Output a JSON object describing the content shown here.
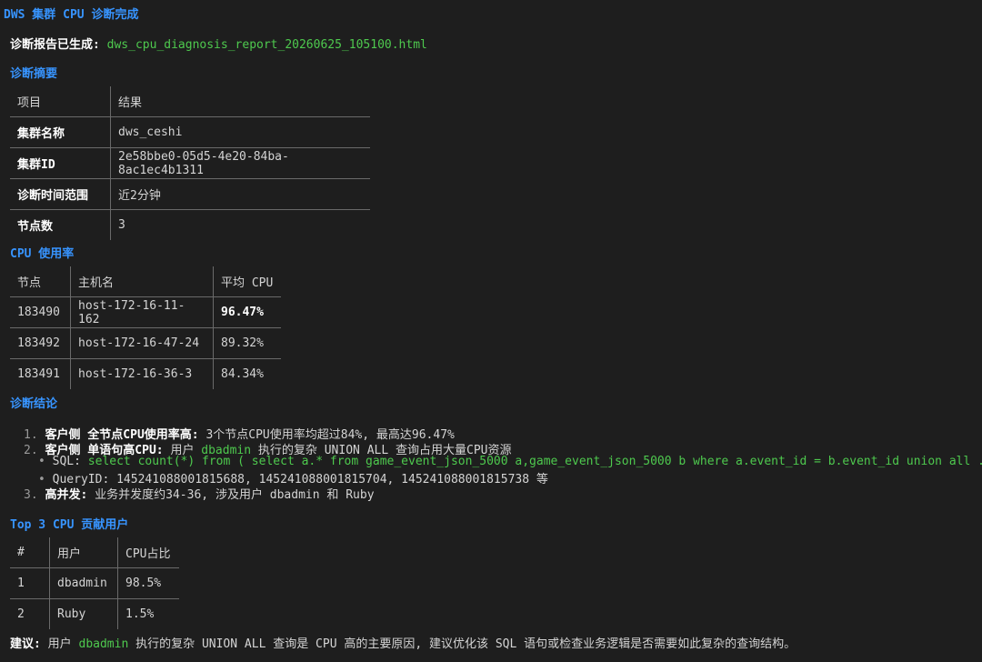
{
  "header": {
    "title": "DWS 集群 CPU 诊断完成"
  },
  "report": {
    "label": "诊断报告已生成:",
    "filename": "dws_cpu_diagnosis_report_20260625_105100.html"
  },
  "summary": {
    "heading": "诊断摘要",
    "columns": [
      "项目",
      "结果"
    ],
    "rows": [
      [
        "集群名称",
        "dws_ceshi"
      ],
      [
        "集群ID",
        "2e58bbe0-05d5-4e20-84ba-8ac1ec4b1311"
      ],
      [
        "诊断时间范围",
        "近2分钟"
      ],
      [
        "节点数",
        "3"
      ]
    ]
  },
  "cpu_usage": {
    "heading": "CPU 使用率",
    "columns": [
      "节点",
      "主机名",
      "平均 CPU"
    ],
    "rows": [
      [
        "183490",
        "host-172-16-11-162",
        "96.47%"
      ],
      [
        "183492",
        "host-172-16-47-24",
        "89.32%"
      ],
      [
        "183491",
        "host-172-16-36-3",
        "84.34%"
      ]
    ]
  },
  "conclusion": {
    "heading": "诊断结论",
    "item1": {
      "num": "1.",
      "title": "客户侧 全节点CPU使用率高",
      "text": "3个节点CPU使用率均超过84%, 最高达96.47%"
    },
    "item2": {
      "num": "2.",
      "title": "客户侧 单语句高CPU",
      "text_pre": "用户 ",
      "user": "dbadmin",
      "text_post": " 执行的复杂 UNION ALL 查询占用大量CPU资源",
      "sql_label": "SQL:",
      "sql": "select count(*) from ( select a.* from game_event_json_5000 a,game_event_json_5000 b where a.event_id = b.event_id union all ... )",
      "query_label": "QueryID:",
      "query": "145241088001815688, 145241088001815704, 145241088001815738 等"
    },
    "item3": {
      "num": "3.",
      "title": "高并发",
      "text": "业务并发度约34-36, 涉及用户 dbadmin 和 Ruby"
    }
  },
  "top_users": {
    "heading": "Top 3 CPU 贡献用户",
    "columns": [
      "#",
      "用户",
      "CPU占比"
    ],
    "rows": [
      [
        "1",
        "dbadmin",
        "98.5%"
      ],
      [
        "2",
        "Ruby",
        "1.5%"
      ]
    ]
  },
  "advice": {
    "label": "建议",
    "pre": "用户 ",
    "user": "dbadmin",
    "post": " 执行的复杂 UNION ALL 查询是 CPU 高的主要原因, 建议优化该 SQL 语句或检查业务逻辑是否需要如此复杂的查询结构。"
  },
  "colors": {
    "background": "#1e1e1e",
    "heading": "#3794ff",
    "accent": "#4ec94e",
    "text": "#d4d4d4"
  }
}
